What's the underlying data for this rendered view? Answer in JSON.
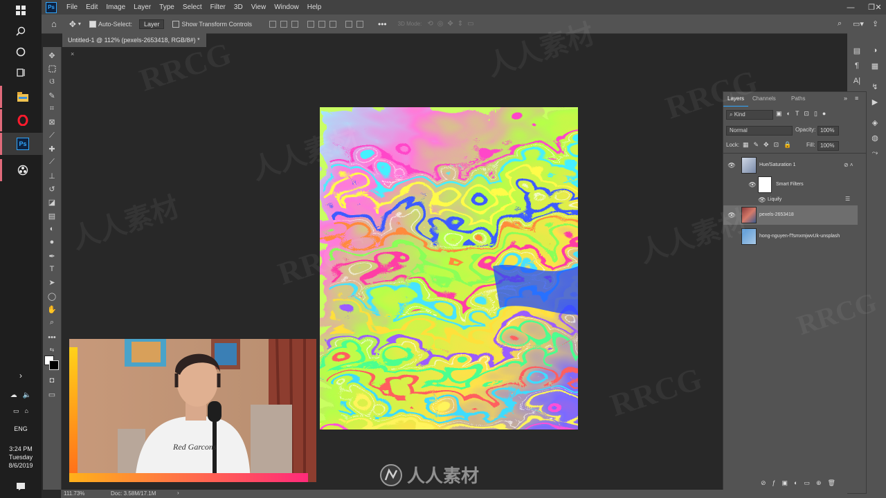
{
  "taskbar": {
    "time": "3:24 PM",
    "day": "Tuesday",
    "date": "8/6/2019",
    "language": "ENG",
    "ps_icon": "Ps"
  },
  "menubar": {
    "logo": "Ps",
    "items": [
      "File",
      "Edit",
      "Image",
      "Layer",
      "Type",
      "Select",
      "Filter",
      "3D",
      "View",
      "Window",
      "Help"
    ]
  },
  "options": {
    "auto_select_label": "Auto-Select:",
    "auto_select_value": "Layer",
    "transform_label": "Show Transform Controls",
    "mode_3d": "3D Mode:"
  },
  "document": {
    "tab_title": "Untitled-1 @ 112% (pexels-2653418, RGB/8#) *"
  },
  "layers_panel": {
    "tabs": [
      "Layers",
      "Channels",
      "Paths"
    ],
    "filter_kind": "Kind",
    "blend_mode": "Normal",
    "opacity_label": "Opacity:",
    "opacity_value": "100%",
    "lock_label": "Lock:",
    "fill_label": "Fill:",
    "fill_value": "100%",
    "layers": [
      {
        "name": "Hue/Saturation 1"
      },
      {
        "name": "Smart Filters"
      },
      {
        "name": "Liquify"
      },
      {
        "name": "pexels-2653418"
      },
      {
        "name": "hong-nguyen-fTsmxmjwvUk-unsplash"
      }
    ]
  },
  "status": {
    "zoom": "111.73%",
    "doc": "Doc: 3.58M/17.1M"
  },
  "watermarks": [
    "RRCG",
    "人人素材",
    "RRCG",
    "人人素材",
    "RRCG",
    "人人素材",
    "RRCG",
    "RRCG",
    "人人素材"
  ],
  "footer_logo": "人人素材",
  "colors": {
    "ps_blue": "#31a8ff",
    "panel": "#535353",
    "workspace": "#282828"
  }
}
